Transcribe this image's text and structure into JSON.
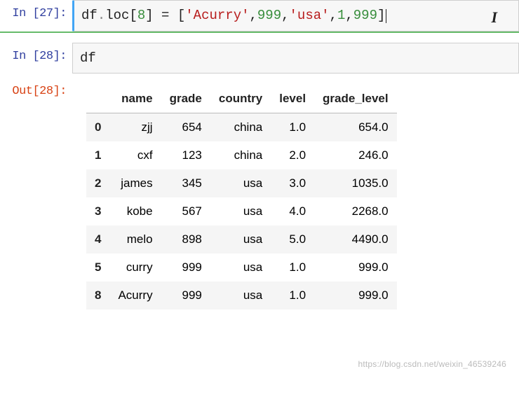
{
  "cell1": {
    "prompt": "In  [27]:",
    "code_plain1": "df",
    "code_period1": ".",
    "code_plain2": "loc",
    "code_bracket_open": "[",
    "code_num1": "8",
    "code_bracket_close": "]",
    "code_eq": " = ",
    "code_list_open": "[",
    "code_str1": "'Acurry'",
    "code_comma1": ",",
    "code_num2": "999",
    "code_comma2": ",",
    "code_str2": "'usa'",
    "code_comma3": ",",
    "code_num3": "1",
    "code_comma4": ",",
    "code_num4": "999",
    "code_list_close": "]"
  },
  "cell2": {
    "prompt": "In  [28]:",
    "code": "df"
  },
  "out": {
    "prompt": "Out[28]:",
    "columns": [
      "name",
      "grade",
      "country",
      "level",
      "grade_level"
    ],
    "index": [
      "0",
      "1",
      "2",
      "3",
      "4",
      "5",
      "8"
    ],
    "rows": [
      [
        "zjj",
        "654",
        "china",
        "1.0",
        "654.0"
      ],
      [
        "cxf",
        "123",
        "china",
        "2.0",
        "246.0"
      ],
      [
        "james",
        "345",
        "usa",
        "3.0",
        "1035.0"
      ],
      [
        "kobe",
        "567",
        "usa",
        "4.0",
        "2268.0"
      ],
      [
        "melo",
        "898",
        "usa",
        "5.0",
        "4490.0"
      ],
      [
        "curry",
        "999",
        "usa",
        "1.0",
        "999.0"
      ],
      [
        "Acurry",
        "999",
        "usa",
        "1.0",
        "999.0"
      ]
    ]
  },
  "watermark": "https://blog.csdn.net/weixin_46539246"
}
